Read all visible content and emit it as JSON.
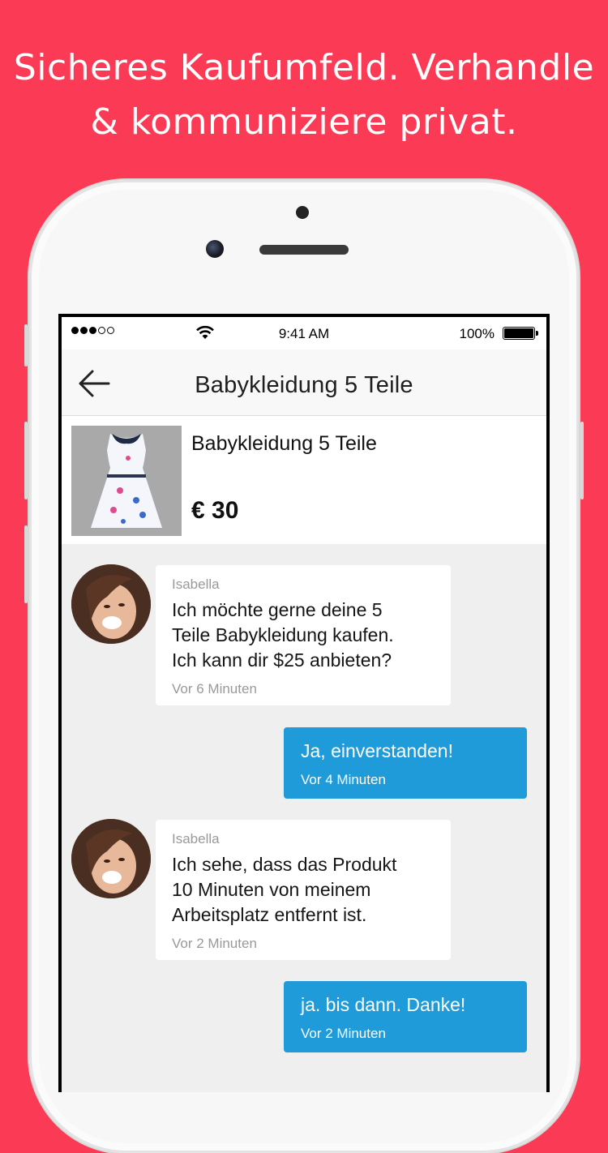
{
  "headline": {
    "line1": "Sicheres Kaufumfeld. Verhandle",
    "line2": "& kommuniziere privat."
  },
  "colors": {
    "background": "#fb3a55",
    "outgoing_bubble": "#1e9bd8",
    "chat_background": "#efefef"
  },
  "statusbar": {
    "signal": "●●●○○",
    "time": "9:41 AM",
    "battery": "100%"
  },
  "nav": {
    "back_icon": "arrow-left-icon",
    "title": "Babykleidung 5 Teile"
  },
  "product": {
    "title": "Babykleidung 5 Teile",
    "price": "€ 30"
  },
  "messages": [
    {
      "direction": "incoming",
      "sender": "Isabella",
      "lines": [
        "Ich möchte gerne deine 5",
        "Teile Babykleidung kaufen.",
        "Ich kann dir $25 anbieten?"
      ],
      "time": "Vor 6 Minuten"
    },
    {
      "direction": "outgoing",
      "text": "Ja, einverstanden!",
      "time": "Vor 4 Minuten"
    },
    {
      "direction": "incoming",
      "sender": "Isabella",
      "lines": [
        "Ich sehe, dass das Produkt",
        "10 Minuten von meinem",
        "Arbeitsplatz entfernt ist."
      ],
      "time": "Vor 2 Minuten"
    },
    {
      "direction": "outgoing",
      "text": "ja. bis dann. Danke!",
      "time": "Vor 2 Minuten"
    }
  ]
}
